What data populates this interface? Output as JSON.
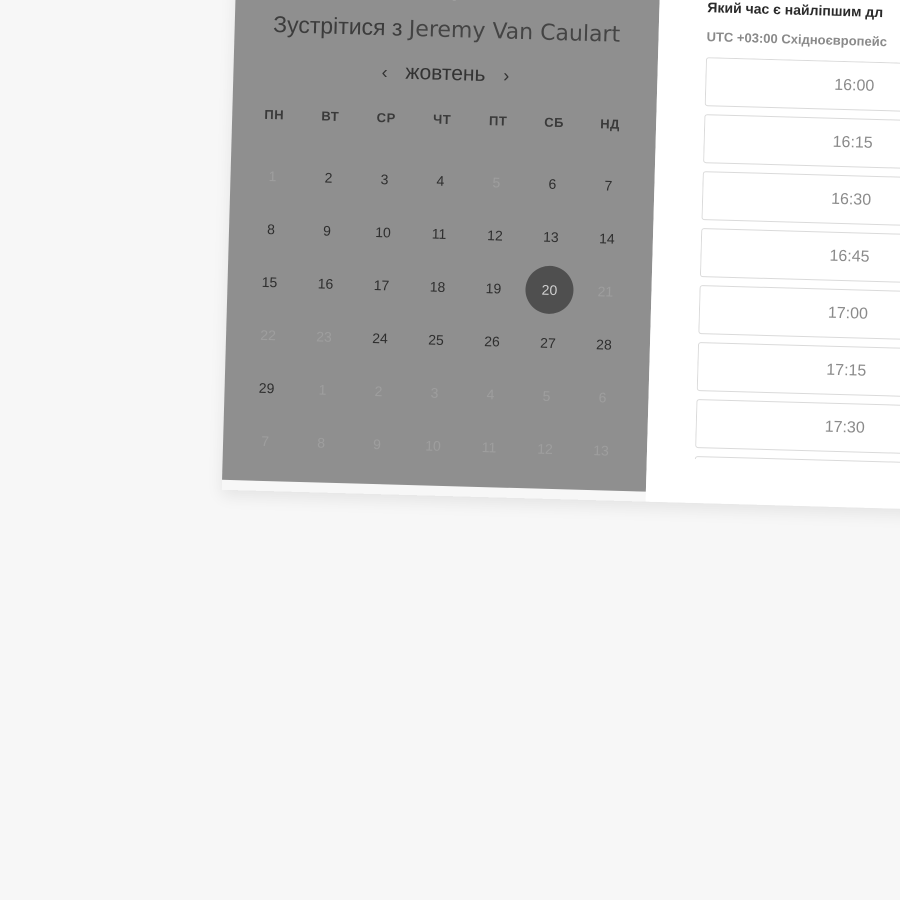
{
  "header": {
    "meet_prefix": "Зустрітися з",
    "host_name": "Jeremy Van Caulart"
  },
  "calendar": {
    "month": "жовтень",
    "prev_icon": "chevron-left-icon",
    "next_icon": "chevron-right-icon",
    "prev_glyph": "‹",
    "next_glyph": "›",
    "weekdays": [
      "ПН",
      "ВТ",
      "СР",
      "ЧТ",
      "ПТ",
      "СБ",
      "НД"
    ],
    "weeks": [
      [
        {
          "d": "1",
          "m": true
        },
        {
          "d": "2"
        },
        {
          "d": "3"
        },
        {
          "d": "4"
        },
        {
          "d": "5",
          "m": true
        },
        {
          "d": "6"
        },
        {
          "d": "7"
        }
      ],
      [
        {
          "d": "8"
        },
        {
          "d": "9"
        },
        {
          "d": "10"
        },
        {
          "d": "11"
        },
        {
          "d": "12"
        },
        {
          "d": "13"
        },
        {
          "d": "14"
        }
      ],
      [
        {
          "d": "15"
        },
        {
          "d": "16"
        },
        {
          "d": "17"
        },
        {
          "d": "18"
        },
        {
          "d": "19"
        },
        {
          "d": "20",
          "sel": true
        },
        {
          "d": "21",
          "m": true
        }
      ],
      [
        {
          "d": "22",
          "m": true
        },
        {
          "d": "23",
          "m": true
        },
        {
          "d": "24"
        },
        {
          "d": "25"
        },
        {
          "d": "26"
        },
        {
          "d": "27"
        },
        {
          "d": "28"
        }
      ],
      [
        {
          "d": "29"
        },
        {
          "d": "1",
          "m": true
        },
        {
          "d": "2",
          "m": true
        },
        {
          "d": "3",
          "m": true
        },
        {
          "d": "4",
          "m": true
        },
        {
          "d": "5",
          "m": true
        },
        {
          "d": "6",
          "m": true
        }
      ],
      [
        {
          "d": "7",
          "m": true
        },
        {
          "d": "8",
          "m": true
        },
        {
          "d": "9",
          "m": true
        },
        {
          "d": "10",
          "m": true
        },
        {
          "d": "11",
          "m": true
        },
        {
          "d": "12",
          "m": true
        },
        {
          "d": "13",
          "m": true
        }
      ]
    ],
    "selected_day": "20"
  },
  "timeslots": {
    "question": "Який час є найліпшим дл",
    "timezone": "UTC +03:00 Східноєвропейс",
    "slots": [
      "16:00",
      "16:15",
      "16:30",
      "16:45",
      "17:00",
      "17:15",
      "17:30",
      ""
    ]
  },
  "colors": {
    "overlay_gray": "#8f8f8f",
    "selected_day_bg": "#4f4f4f",
    "page_bg": "#f7f7f7"
  }
}
